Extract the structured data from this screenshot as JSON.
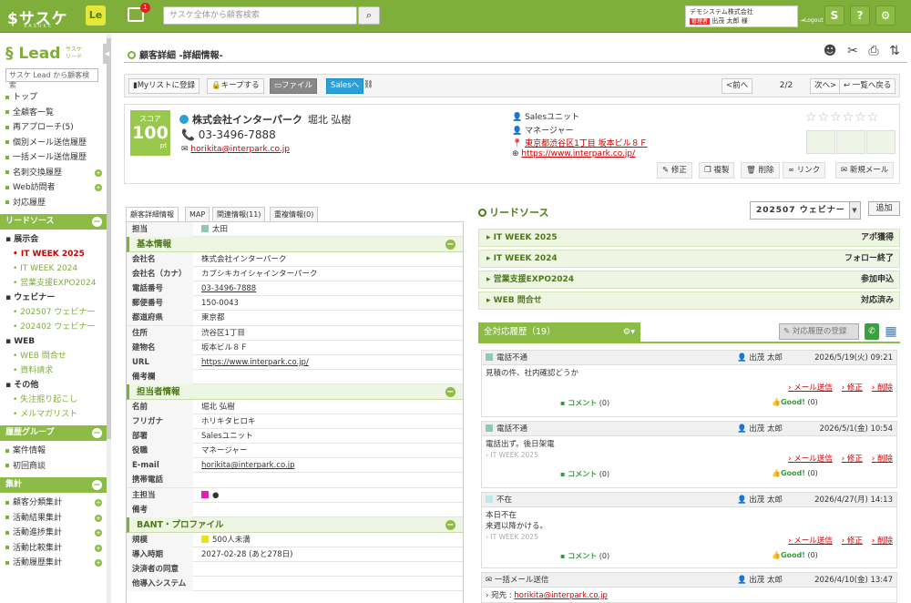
{
  "header": {
    "logo": "サスケ",
    "logo_sub": "SASUKE",
    "app_badge": "Le",
    "notification_count": "1",
    "search_placeholder": "サスケ全体から顧客検索",
    "company": "デモシステム株式会社",
    "role": "管理者",
    "user": "出茂 太郎 様",
    "logout": "Logout",
    "icons": [
      "sasuke-icon",
      "help-icon",
      "gear-icon"
    ]
  },
  "sidebar": {
    "logo": "Lead",
    "logo_sub1": "サスケ",
    "logo_sub2": "リード",
    "search_placeholder": "サスケ Lead から顧客検索",
    "items": [
      "トップ",
      "全顧客一覧",
      "再アプローチ(5)",
      "個別メール送信履歴",
      "一括メール送信履歴",
      "名刺交換履歴",
      "Web訪問者",
      "対応履歴"
    ],
    "lead_source": {
      "title": "リードソース",
      "groups": [
        {
          "name": "展示会",
          "items": [
            "IT WEEK 2025",
            "IT WEEK 2024",
            "営業支援EXPO2024"
          ]
        },
        {
          "name": "ウェビナー",
          "items": [
            "202507 ウェビナー",
            "202402 ウェビナー"
          ]
        },
        {
          "name": "WEB",
          "items": [
            "WEB 問合せ",
            "資料請求"
          ]
        },
        {
          "name": "その他",
          "items": [
            "失注掘り起こし",
            "メルマガリスト"
          ]
        }
      ]
    },
    "history_group": {
      "title": "履歴グループ",
      "items": [
        "案件情報",
        "初回商談"
      ]
    },
    "aggregate": {
      "title": "集計",
      "items": [
        "顧客分類集計",
        "活動結果集計",
        "活動進捗集計",
        "活動比較集計",
        "活動履歴集計"
      ]
    }
  },
  "page": {
    "title": "顧客詳細 -詳細情報-"
  },
  "toolbar": {
    "mylist": "Myリストに登録",
    "keep": "キープする",
    "file": "ファイル",
    "sales": "Salesへ",
    "prev": "<前へ",
    "page": "2/2",
    "next": "次へ>",
    "back": "↩ 一覧へ戻る"
  },
  "customer": {
    "score_label": "スコア",
    "score": "100",
    "score_unit": "pt",
    "company": "株式会社インターパーク",
    "person": "堀北 弘樹",
    "phone": "03-3496-7888",
    "email": "horikita@interpark.co.jp",
    "dept": "Salesユニット",
    "title": "マネージャー",
    "address": "東京都渋谷区1丁目 坂本ビル８Ｆ",
    "url": "https://www.interpark.co.jp/",
    "stars": "☆☆☆☆☆☆"
  },
  "actions": {
    "edit": "修正",
    "copy": "複製",
    "delete": "削除",
    "link": "リンク",
    "newmail": "新規メール"
  },
  "tabs": [
    "顧客詳細情報",
    "MAP",
    "関連情報(11)",
    "重複情報(0)"
  ],
  "detail": {
    "owner_label": "担当",
    "owner": "太田",
    "basic_title": "基本情報",
    "basic": [
      [
        "会社名",
        "株式会社インターパーク"
      ],
      [
        "会社名（カナ）",
        "カブシキカイシャインターパーク"
      ],
      [
        "電話番号",
        "03-3496-7888"
      ],
      [
        "郵便番号",
        "150-0043"
      ],
      [
        "都道府県",
        "東京都"
      ],
      [
        "住所",
        "渋谷区1丁目"
      ],
      [
        "建物名",
        "坂本ビル８Ｆ"
      ],
      [
        "URL",
        "https://www.interpark.co.jp/"
      ],
      [
        "備考欄",
        ""
      ]
    ],
    "contact_title": "担当者情報",
    "contact": [
      [
        "名前",
        "堀北 弘樹"
      ],
      [
        "フリガナ",
        "ホリキタヒロキ"
      ],
      [
        "部署",
        "Salesユニット"
      ],
      [
        "役職",
        "マネージャー"
      ],
      [
        "E-mail",
        "horikita@interpark.co.jp"
      ],
      [
        "携帯電話",
        ""
      ],
      [
        "主担当",
        "●"
      ],
      [
        "備考",
        ""
      ]
    ],
    "bant_title": "BANT・プロファイル",
    "bant": [
      [
        "規模",
        "500人未満"
      ],
      [
        "導入時期",
        "2027-02-28 (あと278日)"
      ],
      [
        "決済者の同意",
        ""
      ],
      [
        "他導入システム",
        ""
      ]
    ]
  },
  "lead": {
    "title": "リードソース",
    "select": "202507 ウェビナー",
    "add": "追加",
    "sources": [
      {
        "name": "IT WEEK 2025",
        "status": "アポ獲得"
      },
      {
        "name": "IT WEEK 2024",
        "status": "フォロー終了"
      },
      {
        "name": "営業支援EXPO2024",
        "status": "参加申込"
      },
      {
        "name": "WEB 問合せ",
        "status": "対応済み"
      }
    ]
  },
  "history": {
    "title": "全対応履歴（19）",
    "register": "対応履歴の登録",
    "entries": [
      {
        "type": "電話不通",
        "user": "出茂 太郎",
        "date": "2026/5/19(火) 09:21",
        "body1": "見積の件、社内確認どうか",
        "body2": "",
        "tag": "",
        "mail": "メール送信",
        "edit": "修正",
        "del": "削除",
        "comment": "コメント",
        "comment_count": "(0)",
        "good": "Good!",
        "good_count": "(0)"
      },
      {
        "type": "電話不通",
        "user": "出茂 太郎",
        "date": "2026/5/1(金) 10:54",
        "body1": "電話出ず。後日架電",
        "body2": "",
        "tag": "IT WEEK 2025",
        "mail": "メール送信",
        "edit": "修正",
        "del": "削除",
        "comment": "コメント",
        "comment_count": "(0)",
        "good": "Good!",
        "good_count": "(0)"
      },
      {
        "type": "不在",
        "user": "出茂 太郎",
        "date": "2026/4/27(月) 14:13",
        "body1": "本日不在",
        "body2": "来週以降かける。",
        "tag": "IT WEEK 2025",
        "mail": "メール送信",
        "edit": "修正",
        "del": "削除",
        "comment": "コメント",
        "comment_count": "(0)",
        "good": "Good!",
        "good_count": "(0)"
      },
      {
        "type": "一括メール送信",
        "user": "出茂 太郎",
        "date": "2026/4/10(金) 13:47",
        "to_label": "宛先",
        "to": "horikita@interpark.co.jp"
      }
    ]
  },
  "colors": {
    "accent": "#7fae3a",
    "owner_chip": "#8fc9b0",
    "main_owner_chip": "#e020b0",
    "size_chip": "#e8e020"
  }
}
